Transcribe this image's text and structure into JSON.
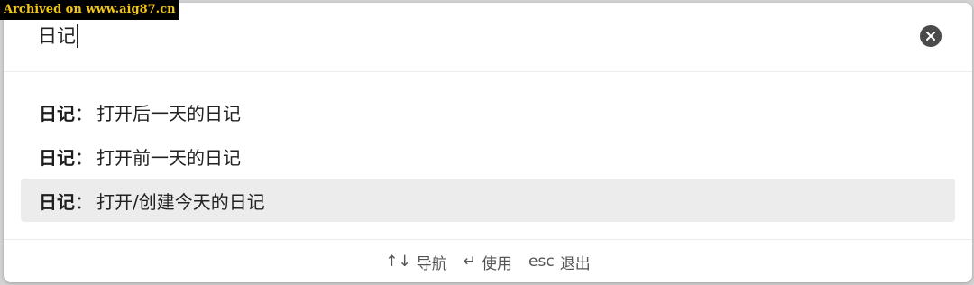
{
  "watermark": "Archived on www.aig87.cn",
  "search": {
    "value": "日记"
  },
  "results": [
    {
      "prefix": "日记",
      "separator": "：",
      "label": "打开后一天的日记",
      "selected": false
    },
    {
      "prefix": "日记",
      "separator": "：",
      "label": "打开前一天的日记",
      "selected": false
    },
    {
      "prefix": "日记",
      "separator": "：",
      "label": "打开/创建今天的日记",
      "selected": true
    }
  ],
  "footer": {
    "navigate_key": "↑↓",
    "navigate_label": "导航",
    "use_key": "↵",
    "use_label": "使用",
    "exit_key": "esc",
    "exit_label": "退出"
  },
  "icons": {
    "clear": "close-circle-icon"
  },
  "colors": {
    "selected_row": "#ececec",
    "clear_button": "#4a4a4a"
  }
}
